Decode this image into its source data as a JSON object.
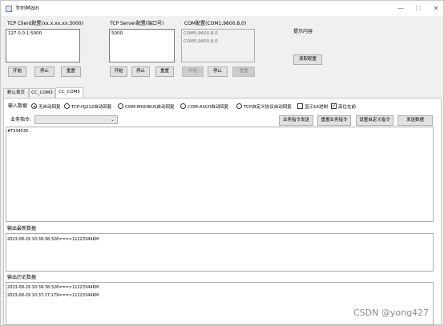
{
  "window": {
    "title": "frmMain",
    "minimize_glyph": "—",
    "maximize_glyph": "☐",
    "close_glyph": "✕"
  },
  "tcp_client": {
    "label": "TCP Client配置(xx.x.xx.xx:3000)",
    "items": [
      "127.0.0.1:5000"
    ],
    "buttons": {
      "start": "开始",
      "stop": "停止",
      "reset": "重置"
    }
  },
  "tcp_server": {
    "label": "TCP Server配置(端口号)",
    "items": [
      "5000"
    ],
    "buttons": {
      "start": "开始",
      "stop": "停止",
      "reset": "重置"
    }
  },
  "com": {
    "label": "COM配置(COM1,9600,8,0)",
    "items": [
      "COM5,9600,8,0",
      "COM5,9600,8,0"
    ],
    "buttons": {
      "start": "开始",
      "stop": "停止",
      "reset": "重置"
    }
  },
  "hint": {
    "label": "提示内容",
    "read_config_button": "读取配置"
  },
  "tabs": [
    "默认首页",
    "CC_COM3",
    "CC_COM5"
  ],
  "options": {
    "input_label": "输入数据",
    "radios": [
      "无自动回复",
      "TCP-HJ212自动回复",
      "COM-MODBUS自动回复",
      "COM-ASCII自动回复",
      "TCP自定义协议自动回复"
    ],
    "selected_radio": 0,
    "hex_display": "显示16进制",
    "top_most": "高位在前",
    "hex_display_checked": false,
    "top_most_checked": true,
    "check_glyph": "✓"
  },
  "command": {
    "label": "业务指令:",
    "select_value": "",
    "chevron": "⌄",
    "buttons": [
      "业务指令发送",
      "重置业务指令",
      "设置自定义指令",
      "发送数据"
    ]
  },
  "send_box": {
    "lines": [
      "#T334535"
    ]
  },
  "latest": {
    "label": "输出最新数据",
    "lines": [
      "2023-08-29 10:39:38:326===>11223344KM"
    ]
  },
  "history": {
    "label": "输出历史数据",
    "lines": [
      "2023-08-29 10:39:38:326===>11223344KM",
      "2023-08-29 10:37:27:179===>11223344KM"
    ]
  },
  "watermark": "CSDN @yong427"
}
